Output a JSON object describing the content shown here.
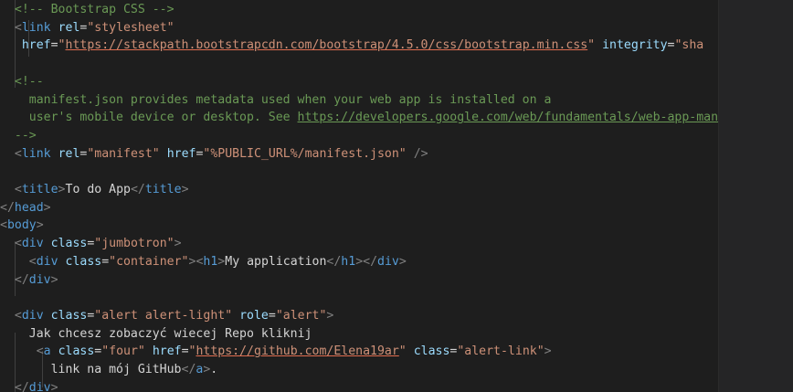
{
  "lines": [
    {
      "indent": "  ",
      "tokens": [
        {
          "k": "c",
          "v": "<!-- Bootstrap CSS -->"
        }
      ]
    },
    {
      "indent": "  ",
      "tokens": [
        {
          "k": "p",
          "v": "<"
        },
        {
          "k": "t",
          "v": "link"
        },
        {
          "k": "x",
          "v": " "
        },
        {
          "k": "a",
          "v": "rel"
        },
        {
          "k": "x",
          "v": "="
        },
        {
          "k": "s",
          "v": "\"stylesheet\""
        }
      ]
    },
    {
      "indent": "   ",
      "tokens": [
        {
          "k": "a",
          "v": "href"
        },
        {
          "k": "x",
          "v": "="
        },
        {
          "k": "s",
          "v": "\""
        },
        {
          "k": "su",
          "v": "https://stackpath.bootstrapcdn.com/bootstrap/4.5.0/css/bootstrap.min.css"
        },
        {
          "k": "s",
          "v": "\""
        },
        {
          "k": "x",
          "v": " "
        },
        {
          "k": "a",
          "v": "integrity"
        },
        {
          "k": "x",
          "v": "="
        },
        {
          "k": "s",
          "v": "\"sha"
        }
      ]
    },
    {
      "indent": "",
      "tokens": []
    },
    {
      "indent": "  ",
      "tokens": [
        {
          "k": "c",
          "v": "<!--"
        }
      ]
    },
    {
      "indent": "    ",
      "tokens": [
        {
          "k": "c",
          "v": "manifest.json provides metadata used when your web app is installed on a"
        }
      ]
    },
    {
      "indent": "    ",
      "tokens": [
        {
          "k": "c",
          "v": "user's mobile device or desktop. See "
        },
        {
          "k": "cu",
          "v": "https://developers.google.com/web/fundamentals/web-app-man"
        }
      ]
    },
    {
      "indent": "  ",
      "tokens": [
        {
          "k": "c",
          "v": "-->"
        }
      ]
    },
    {
      "indent": "  ",
      "tokens": [
        {
          "k": "p",
          "v": "<"
        },
        {
          "k": "t",
          "v": "link"
        },
        {
          "k": "x",
          "v": " "
        },
        {
          "k": "a",
          "v": "rel"
        },
        {
          "k": "x",
          "v": "="
        },
        {
          "k": "s",
          "v": "\"manifest\""
        },
        {
          "k": "x",
          "v": " "
        },
        {
          "k": "a",
          "v": "href"
        },
        {
          "k": "x",
          "v": "="
        },
        {
          "k": "s",
          "v": "\"%PUBLIC_URL%/manifest.json\""
        },
        {
          "k": "x",
          "v": " "
        },
        {
          "k": "p",
          "v": "/>"
        }
      ]
    },
    {
      "indent": "",
      "tokens": []
    },
    {
      "indent": "  ",
      "tokens": [
        {
          "k": "p",
          "v": "<"
        },
        {
          "k": "t",
          "v": "title"
        },
        {
          "k": "p",
          "v": ">"
        },
        {
          "k": "x",
          "v": "To do App"
        },
        {
          "k": "p",
          "v": "</"
        },
        {
          "k": "t",
          "v": "title"
        },
        {
          "k": "p",
          "v": ">"
        }
      ]
    },
    {
      "indent": "",
      "tokens": [
        {
          "k": "p",
          "v": "</"
        },
        {
          "k": "t",
          "v": "head"
        },
        {
          "k": "p",
          "v": ">"
        }
      ]
    },
    {
      "indent": "",
      "tokens": [
        {
          "k": "p",
          "v": "<"
        },
        {
          "k": "t",
          "v": "body"
        },
        {
          "k": "p",
          "v": ">"
        }
      ]
    },
    {
      "indent": "  ",
      "tokens": [
        {
          "k": "p",
          "v": "<"
        },
        {
          "k": "t",
          "v": "div"
        },
        {
          "k": "x",
          "v": " "
        },
        {
          "k": "a",
          "v": "class"
        },
        {
          "k": "x",
          "v": "="
        },
        {
          "k": "s",
          "v": "\"jumbotron\""
        },
        {
          "k": "p",
          "v": ">"
        }
      ]
    },
    {
      "indent": "    ",
      "tokens": [
        {
          "k": "p",
          "v": "<"
        },
        {
          "k": "t",
          "v": "div"
        },
        {
          "k": "x",
          "v": " "
        },
        {
          "k": "a",
          "v": "class"
        },
        {
          "k": "x",
          "v": "="
        },
        {
          "k": "s",
          "v": "\"container\""
        },
        {
          "k": "p",
          "v": ">"
        },
        {
          "k": "p",
          "v": "<"
        },
        {
          "k": "t",
          "v": "h1"
        },
        {
          "k": "p",
          "v": ">"
        },
        {
          "k": "x",
          "v": "My application"
        },
        {
          "k": "p",
          "v": "</"
        },
        {
          "k": "t",
          "v": "h1"
        },
        {
          "k": "p",
          "v": ">"
        },
        {
          "k": "p",
          "v": "</"
        },
        {
          "k": "t",
          "v": "div"
        },
        {
          "k": "p",
          "v": ">"
        }
      ]
    },
    {
      "indent": "  ",
      "tokens": [
        {
          "k": "p",
          "v": "</"
        },
        {
          "k": "t",
          "v": "div"
        },
        {
          "k": "p",
          "v": ">"
        }
      ]
    },
    {
      "indent": "",
      "tokens": []
    },
    {
      "indent": "  ",
      "tokens": [
        {
          "k": "p",
          "v": "<"
        },
        {
          "k": "t",
          "v": "div"
        },
        {
          "k": "x",
          "v": " "
        },
        {
          "k": "a",
          "v": "class"
        },
        {
          "k": "x",
          "v": "="
        },
        {
          "k": "s",
          "v": "\"alert alert-light\""
        },
        {
          "k": "x",
          "v": " "
        },
        {
          "k": "a",
          "v": "role"
        },
        {
          "k": "x",
          "v": "="
        },
        {
          "k": "s",
          "v": "\"alert\""
        },
        {
          "k": "p",
          "v": ">"
        }
      ]
    },
    {
      "indent": "    ",
      "tokens": [
        {
          "k": "x",
          "v": "Jak chcesz zobaczyć wiecej Repo kliknij"
        }
      ]
    },
    {
      "indent": "     ",
      "tokens": [
        {
          "k": "p",
          "v": "<"
        },
        {
          "k": "t",
          "v": "a"
        },
        {
          "k": "x",
          "v": " "
        },
        {
          "k": "a",
          "v": "class"
        },
        {
          "k": "x",
          "v": "="
        },
        {
          "k": "s",
          "v": "\"four\""
        },
        {
          "k": "x",
          "v": " "
        },
        {
          "k": "a",
          "v": "href"
        },
        {
          "k": "x",
          "v": "="
        },
        {
          "k": "s",
          "v": "\""
        },
        {
          "k": "su",
          "v": "https://github.com/Elena19ar"
        },
        {
          "k": "s",
          "v": "\""
        },
        {
          "k": "x",
          "v": " "
        },
        {
          "k": "a",
          "v": "class"
        },
        {
          "k": "x",
          "v": "="
        },
        {
          "k": "s",
          "v": "\"alert-link\""
        },
        {
          "k": "p",
          "v": ">"
        }
      ]
    },
    {
      "indent": "       ",
      "tokens": [
        {
          "k": "x",
          "v": "link na mój GitHub"
        },
        {
          "k": "p",
          "v": "</"
        },
        {
          "k": "t",
          "v": "a"
        },
        {
          "k": "p",
          "v": ">"
        },
        {
          "k": "x",
          "v": "."
        }
      ]
    },
    {
      "indent": "  ",
      "tokens": [
        {
          "k": "p",
          "v": "</"
        },
        {
          "k": "t",
          "v": "div"
        },
        {
          "k": "p",
          "v": ">"
        }
      ]
    }
  ]
}
